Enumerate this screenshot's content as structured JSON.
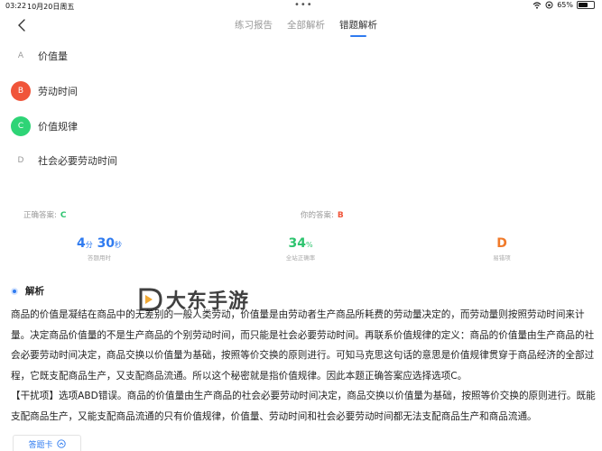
{
  "status_bar": {
    "time": "03:22",
    "date": "10月20日周五",
    "battery": "65%",
    "battery_level": 0.65
  },
  "nav": {
    "tabs": [
      {
        "label": "练习报告"
      },
      {
        "label": "全部解析"
      },
      {
        "label": "错题解析"
      }
    ],
    "active_tab": 2
  },
  "options": [
    {
      "letter": "A",
      "text": "价值量",
      "state": "normal"
    },
    {
      "letter": "B",
      "text": "劳动时间",
      "state": "wrong"
    },
    {
      "letter": "C",
      "text": "价值规律",
      "state": "correct"
    },
    {
      "letter": "D",
      "text": "社会必要劳动时间",
      "state": "normal"
    }
  ],
  "answers": {
    "correct_label": "正确答案:",
    "correct_value": "C",
    "yours_label": "你的答案:",
    "yours_value": "B"
  },
  "stats": {
    "time_min": "4",
    "time_min_unit": "分",
    "time_sec": "30",
    "time_sec_unit": "秒",
    "time_caption": "答题用时",
    "rate_value": "34",
    "rate_unit": "%",
    "rate_caption": "全站正确率",
    "wrong_value": "D",
    "wrong_caption": "易错项"
  },
  "analysis": {
    "title": "解析",
    "watermark": "大东手游",
    "body": "商品的价值是凝结在商品中的无差别的一般人类劳动，价值量是由劳动者生产商品所耗费的劳动量决定的，而劳动量则按照劳动时间来计量。决定商品价值量的不是生产商品的个别劳动时间，而只能是社会必要劳动时间。再联系价值规律的定义：商品的价值量由生产商品的社会必要劳动时间决定，商品交换以价值量为基础，按照等价交换的原则进行。可知马克思这句话的意思是价值规律贯穿于商品经济的全部过程，它既支配商品生产，又支配商品流通。所以这个秘密就是指价值规律。因此本题正确答案应选择选项C。",
    "body2": "【干扰项】选项ABD错误。商品的价值量由生产商品的社会必要劳动时间决定，商品交换以价值量为基础，按照等价交换的原则进行。既能支配商品生产，又能支配商品流通的只有价值规律，价值量、劳动时间和社会必要劳动时间都无法支配商品生产和商品流通。"
  },
  "answer_card": {
    "label": "答题卡"
  },
  "colors": {
    "accent": "#2f7bf0",
    "wrong": "#f0553a",
    "correct": "#2ed476",
    "wrong_item": "#f07a2a"
  }
}
